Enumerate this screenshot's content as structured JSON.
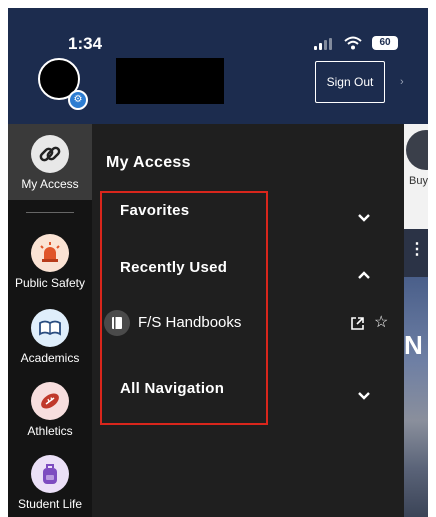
{
  "status_bar": {
    "time": "1:34",
    "battery": "60"
  },
  "header": {
    "sign_out_label": "Sign Out"
  },
  "sidebar": {
    "items": [
      {
        "label": "My Access",
        "icon": "link-icon"
      },
      {
        "label": "Public Safety",
        "icon": "siren-icon"
      },
      {
        "label": "Academics",
        "icon": "book-icon"
      },
      {
        "label": "Athletics",
        "icon": "football-icon"
      },
      {
        "label": "Student Life",
        "icon": "backpack-icon"
      }
    ]
  },
  "menu": {
    "title": "My Access",
    "sections": {
      "favorites": {
        "label": "Favorites",
        "expanded": false
      },
      "recently_used": {
        "label": "Recently Used",
        "expanded": true,
        "items": [
          {
            "label": "F/S Handbooks"
          }
        ]
      },
      "all_navigation": {
        "label": "All Navigation",
        "expanded": false
      }
    }
  },
  "background": {
    "side_text": "Buy",
    "banner_letter": "N"
  },
  "colors": {
    "header_bg": "#1c2c4e",
    "panel_bg": "#1f1f1f",
    "sidebar_bg": "#141414",
    "highlight": "#d9261c"
  }
}
